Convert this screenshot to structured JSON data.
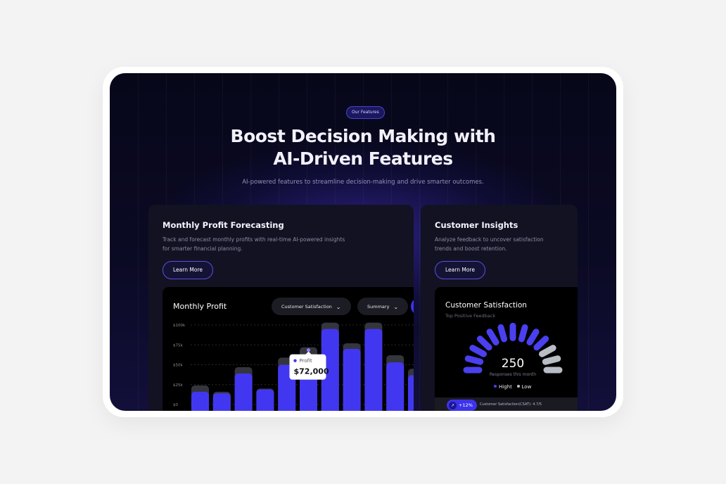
{
  "hero": {
    "badge": "Our Features",
    "title_line1": "Boost Decision Making with",
    "title_line2": "AI-Driven Features",
    "subtitle": "AI-powered features to streamline decision-making and drive smarter outcomes."
  },
  "cards": {
    "profit": {
      "title": "Monthly Profit Forecasting",
      "desc_line1": "Track and forecast monthly profits with real-time AI-powered insights",
      "desc_line2": "for smarter financial planning.",
      "button": "Learn More"
    },
    "insights": {
      "title": "Customer Insights",
      "desc_line1": "Analyze feedback to uncover satisfaction",
      "desc_line2": "trends and boost retention.",
      "button": "Learn More"
    }
  },
  "profit_panel": {
    "title": "Monthly Profit",
    "dropdown1": "Customer Satisfaction",
    "dropdown2": "Summary",
    "tooltip_label": "Profit",
    "tooltip_value": "$72,000"
  },
  "chart_data": {
    "type": "bar",
    "title": "Monthly Profit",
    "y_ticks": [
      "$100k",
      "$75k",
      "$50k",
      "$25k",
      "$0"
    ],
    "ylim": [
      0,
      100
    ],
    "y_unit": "k",
    "grid": true,
    "series": [
      {
        "values": [
          16,
          14,
          39,
          19,
          50,
          52,
          95,
          70,
          95,
          53,
          37
        ]
      },
      {
        "values": [
          24,
          16,
          47,
          20,
          59,
          72,
          103,
          77,
          103,
          62,
          45
        ]
      }
    ],
    "highlight_index": 5,
    "colors": {
      "bar": "#4237f0",
      "bar_back": "#35353d",
      "grid": "#2a2a33",
      "tick": "#8c8b9c"
    }
  },
  "csat_panel": {
    "title": "Customer Satisfaction",
    "subtitle": "Top Positive Feedback",
    "value": "250",
    "value_caption": "Responses this month",
    "legend_high": "Hight",
    "legend_low": "Low",
    "trend": "+12%",
    "trend_icon": "arrow-up-right-icon",
    "strip_text": "Customer Satisfaction(CSAT): 4.7/5",
    "high_segments": 10,
    "total_segments": 13,
    "colors": {
      "high": "#4a40f0",
      "low": "#b8bcc4"
    }
  }
}
